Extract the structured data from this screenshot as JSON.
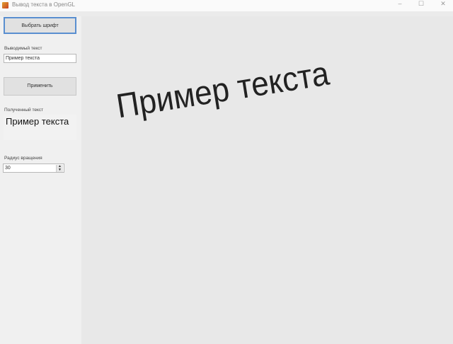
{
  "window": {
    "title": "Вывод текста в OpenGL",
    "minimize": "–",
    "maximize": "☐",
    "close": "✕"
  },
  "sidebar": {
    "font_button": "Выбрать шрифт",
    "output_label": "Выводимый текст",
    "output_value": "Пример текста",
    "apply_button": "Применить",
    "result_label": "Полученный текст",
    "result_value": "Пример текста",
    "radius_label": "Радиус вращения",
    "radius_value": "30"
  },
  "canvas": {
    "rendered_text": "Пример текста",
    "rotation_deg": 9
  }
}
